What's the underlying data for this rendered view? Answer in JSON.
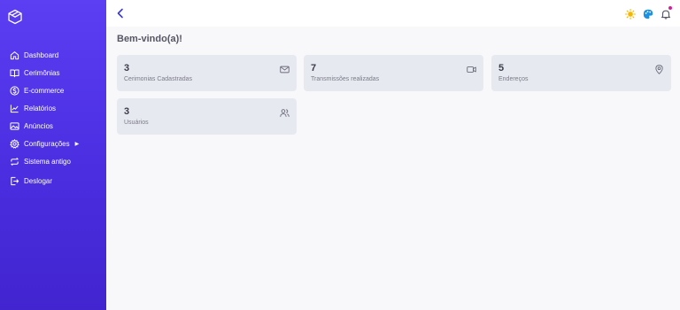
{
  "sidebar": {
    "items": [
      {
        "label": "Dashboard",
        "icon": "home-icon"
      },
      {
        "label": "Cerimônias",
        "icon": "book-icon"
      },
      {
        "label": "E-commerce",
        "icon": "dollar-circle-icon"
      },
      {
        "label": "Relatórios",
        "icon": "chart-icon"
      },
      {
        "label": "Anúncios",
        "icon": "image-icon"
      },
      {
        "label": "Configurações",
        "icon": "gear-icon",
        "caret": "▶"
      },
      {
        "label": "Sistema antigo",
        "icon": "refresh-icon"
      },
      {
        "label": "Deslogar",
        "icon": "logout-icon"
      }
    ]
  },
  "header": {
    "icons": [
      "back-icon",
      "sun-icon",
      "palette-icon",
      "bell-icon"
    ],
    "notification_color": "#d81b9b"
  },
  "main": {
    "title": "Bem-vindo(a)!",
    "cards": [
      {
        "value": "3",
        "label": "Cerimonias Cadastradas",
        "icon": "mail-icon"
      },
      {
        "value": "7",
        "label": "Transmissões realizadas",
        "icon": "video-icon"
      },
      {
        "value": "5",
        "label": "Endereços",
        "icon": "map-pin-icon"
      },
      {
        "value": "3",
        "label": "Usuários",
        "icon": "users-icon"
      }
    ]
  },
  "colors": {
    "sidebar_top": "#5c3ef3",
    "sidebar_bottom": "#4225cf",
    "card_bg": "#e7e9f1",
    "sun": "#f5b800",
    "palette": "#1f8fe0"
  }
}
